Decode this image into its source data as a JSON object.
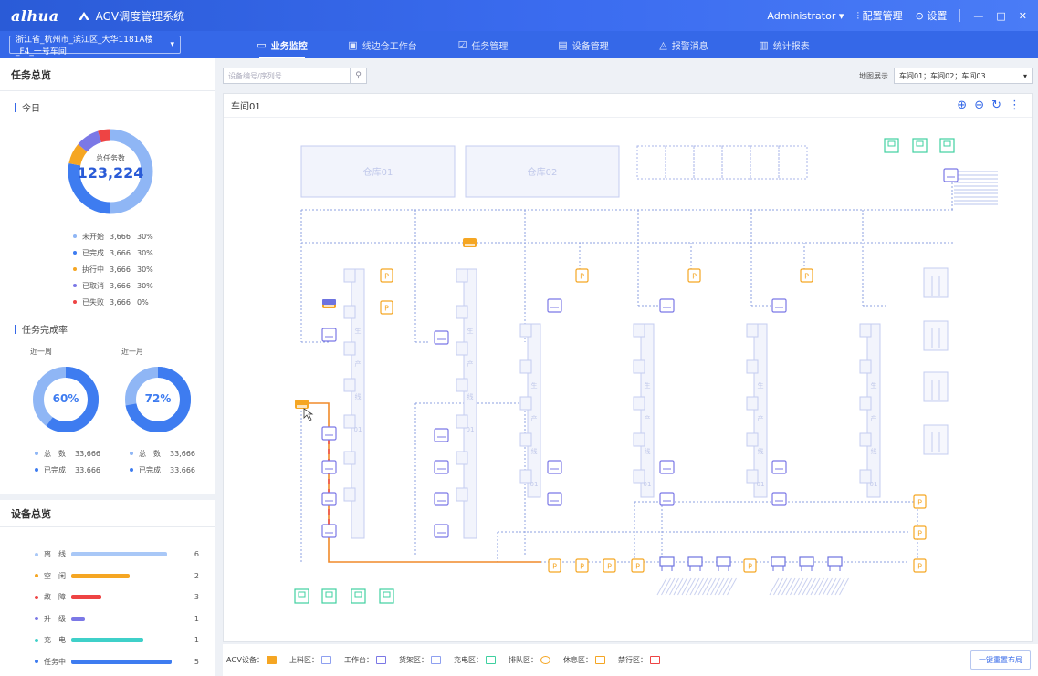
{
  "titlebar": {
    "logo": "alhua",
    "sep": "–",
    "app_title": "AGV调度管理系统",
    "user": "Administrator",
    "config": "配置管理",
    "settings": "设置"
  },
  "nav": {
    "site": "浙江省_杭州市_滨江区_大华1181A楼_F4_一号车间",
    "tabs": [
      {
        "label": "业务监控",
        "icon": "monitor-icon"
      },
      {
        "label": "线边仓工作台",
        "icon": "workstation-icon"
      },
      {
        "label": "任务管理",
        "icon": "task-icon"
      },
      {
        "label": "设备管理",
        "icon": "device-icon"
      },
      {
        "label": "报警消息",
        "icon": "bell-icon"
      },
      {
        "label": "统计报表",
        "icon": "chart-icon"
      }
    ]
  },
  "left": {
    "task_overview": "任务总览",
    "today": "今日",
    "total_label": "总任务数",
    "total_value": "123,224",
    "status_legend": [
      {
        "label": "未开始",
        "count": "3,666",
        "pct": "30%",
        "color": "#8fb6f5"
      },
      {
        "label": "已完成",
        "count": "3,666",
        "pct": "30%",
        "color": "#3e7cf0"
      },
      {
        "label": "执行中",
        "count": "3,666",
        "pct": "30%",
        "color": "#f5a623"
      },
      {
        "label": "已取消",
        "count": "3,666",
        "pct": "30%",
        "color": "#7b78e6"
      },
      {
        "label": "已失败",
        "count": "3,666",
        "pct": "0%",
        "color": "#ee4444"
      }
    ],
    "ring_segments": [
      0.5,
      0.28,
      0.08,
      0.09,
      0.05
    ],
    "completion_title": "任务完成率",
    "week": {
      "label": "近一周",
      "pct_text": "60%",
      "value": 0.6
    },
    "month": {
      "label": "近一月",
      "pct_text": "72%",
      "value": 0.72
    },
    "week_stats": [
      {
        "label": "总　数",
        "value": "33,666"
      },
      {
        "label": "已完成",
        "value": "33,666"
      }
    ],
    "month_stats": [
      {
        "label": "总　数",
        "value": "33,666"
      },
      {
        "label": "已完成",
        "value": "33,666"
      }
    ],
    "device_overview": "设备总览",
    "devices": [
      {
        "label": "离　线",
        "value": "6",
        "fill": 0.95,
        "color": "#a9c8f7"
      },
      {
        "label": "空　闲",
        "value": "2",
        "fill": 0.58,
        "color": "#f5a623"
      },
      {
        "label": "故　障",
        "value": "3",
        "fill": 0.3,
        "color": "#ee4444"
      },
      {
        "label": "升　级",
        "value": "1",
        "fill": 0.14,
        "color": "#7b78e6"
      },
      {
        "label": "充　电",
        "value": "1",
        "fill": 0.72,
        "color": "#3fd0c9"
      },
      {
        "label": "任务中",
        "value": "5",
        "fill": 1.0,
        "color": "#3e7cf0"
      }
    ]
  },
  "main": {
    "search_placeholder": "设备编号/序列号",
    "map_display_label": "地图展示",
    "map_select": "车间01；车间02；车间03",
    "map_title": "车间01",
    "warehouses": [
      "仓库01",
      "仓库02"
    ],
    "shelf_chars": [
      "生",
      "产",
      "线",
      "01"
    ]
  },
  "footer": {
    "legend": [
      {
        "label": "AGV设备：",
        "color": "#f5a623",
        "icon": "agv-icon"
      },
      {
        "label": "上料区：",
        "color": "#8ea0f0",
        "icon": "loading-area-icon"
      },
      {
        "label": "工作台：",
        "color": "#7b78e6",
        "icon": "workbench-icon"
      },
      {
        "label": "货架区：",
        "color": "#8ea0f0",
        "icon": "shelf-area-icon"
      },
      {
        "label": "充电区：",
        "color": "#3fd0a0",
        "icon": "charging-area-icon"
      },
      {
        "label": "排队区：",
        "color": "#f5a623",
        "icon": "queue-area-icon"
      },
      {
        "label": "休息区：",
        "color": "#f5a623",
        "icon": "rest-area-icon"
      },
      {
        "label": "禁行区：",
        "color": "#ee4444",
        "icon": "no-entry-icon"
      }
    ],
    "relayout": "一键重置布局"
  }
}
